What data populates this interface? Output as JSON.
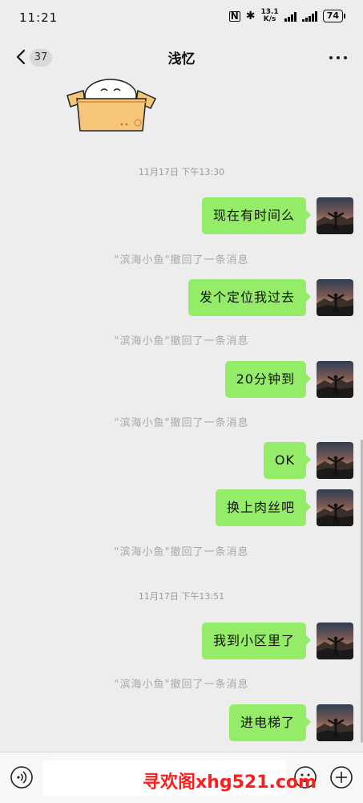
{
  "status_bar": {
    "time": "11:21",
    "net_speed_value": "13.1",
    "net_speed_unit": "K/s",
    "battery": "74"
  },
  "header": {
    "back_icon": "chevron-left-icon",
    "unread_count": "37",
    "title": "浅忆",
    "more_icon": "more-horizontal-icon"
  },
  "chat": {
    "timestamps": [
      "11月17日 下午13:30",
      "11月17日 下午13:51"
    ],
    "system_recall": "\"滨海小鱼\"撤回了一条消息",
    "messages": [
      {
        "text": "现在有时间么"
      },
      {
        "text": "发个定位我过去"
      },
      {
        "text": "20分钟到"
      },
      {
        "text": "OK"
      },
      {
        "text": "换上肉丝吧"
      },
      {
        "text": "我到小区里了"
      },
      {
        "text": "进电梯了"
      }
    ]
  },
  "input_bar": {
    "voice_icon": "voice-icon",
    "input_value": "",
    "emoji_icon": "emoji-icon",
    "add_icon": "add-icon"
  },
  "watermark": "寻欢阁xhg521.com",
  "colors": {
    "background": "#ededed",
    "bubble": "#95ec69",
    "watermark": "#ff1e1e"
  }
}
